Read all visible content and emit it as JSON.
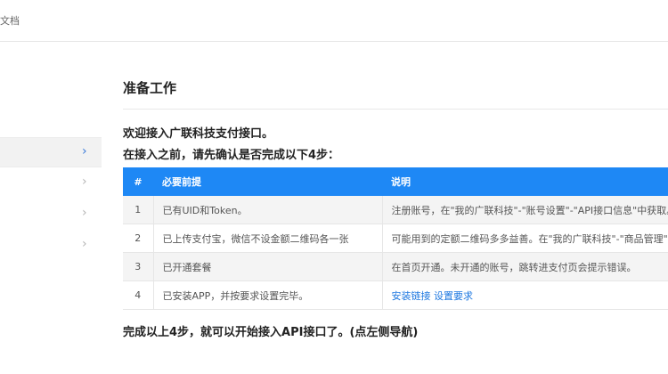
{
  "header": {
    "breadcrumb": "文档"
  },
  "sidebar": {
    "items": [
      {
        "active": true
      },
      {
        "active": false
      },
      {
        "active": false
      },
      {
        "active": false
      }
    ],
    "chevron": "›"
  },
  "main": {
    "title": "准备工作",
    "intro_line1": "欢迎接入广联科技支付接口。",
    "intro_line2": "在接入之前，请先确认是否完成以下4步：",
    "table": {
      "headers": {
        "num": "#",
        "req": "必要前提",
        "desc": "说明"
      },
      "rows": [
        {
          "num": "1",
          "req": "已有UID和Token。",
          "desc": "注册账号，在\"我的广联科技\"-\"账号设置\"-\"API接口信息\"中获取。"
        },
        {
          "num": "2",
          "req": "已上传支付宝，微信不设金额二维码各一张",
          "desc": "可能用到的定额二维码多多益善。在\"我的广联科技\"-\"商品管理\"中上传。"
        },
        {
          "num": "3",
          "req": "已开通套餐",
          "desc": "在首页开通。未开通的账号，跳转进支付页会提示错误。"
        },
        {
          "num": "4",
          "req": "已安装APP，并按要求设置完毕。",
          "link1": "安装链接",
          "link2": "设置要求"
        }
      ]
    },
    "footer_note": "完成以上4步，就可以开始接入API接口了。(点左侧导航)"
  },
  "colors": {
    "accent": "#1e88f5",
    "link": "#1e78e0"
  }
}
